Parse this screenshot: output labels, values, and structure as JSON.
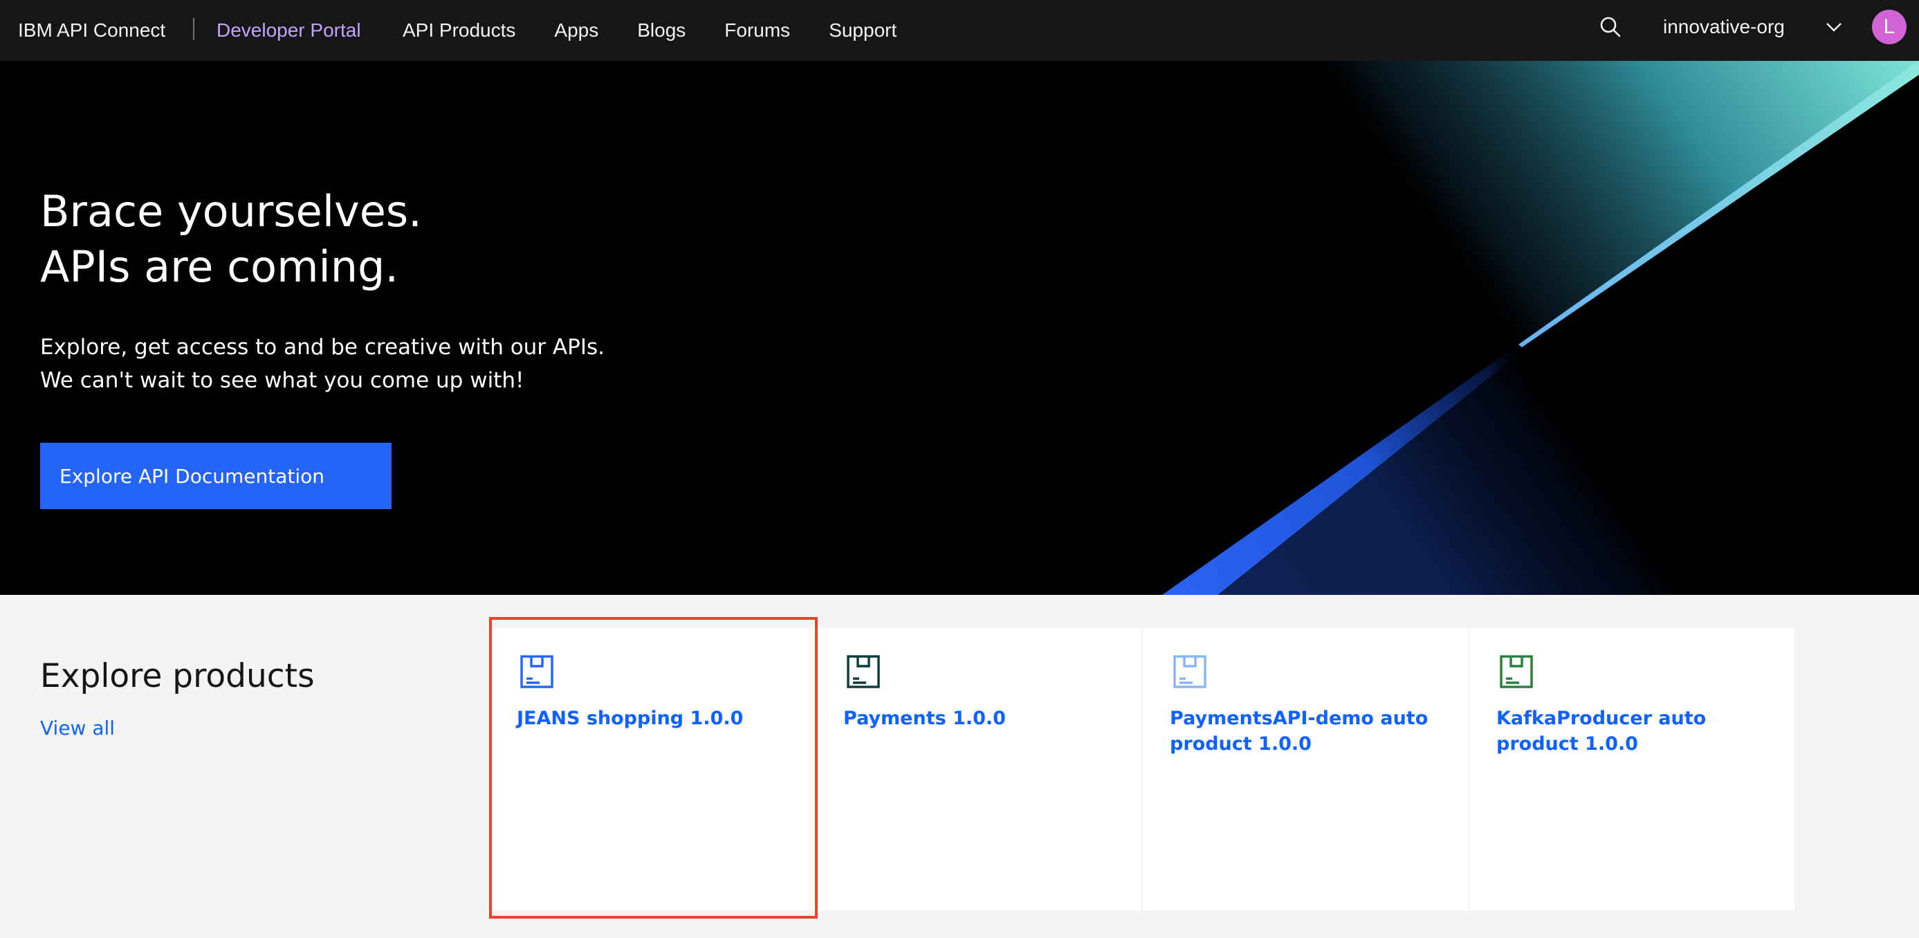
{
  "header": {
    "brand": "IBM API Connect",
    "portal_label": "Developer Portal",
    "nav_items": [
      {
        "label": "API Products"
      },
      {
        "label": "Apps"
      },
      {
        "label": "Blogs"
      },
      {
        "label": "Forums"
      },
      {
        "label": "Support"
      }
    ],
    "org_name": "innovative-org",
    "avatar_initial": "L",
    "icons": {
      "search": "search-icon",
      "org_dropdown": "chevron-down-icon"
    }
  },
  "hero": {
    "title_line1": "Brace yourselves.",
    "title_line2": "APIs are coming.",
    "subtitle_line1": "Explore, get access to and be creative with our APIs.",
    "subtitle_line2": "We can't wait to see what you come up with!",
    "cta_label": "Explore API Documentation"
  },
  "products": {
    "heading": "Explore products",
    "view_all_label": "View all",
    "items": [
      {
        "title": "JEANS shopping 1.0.0",
        "icon": "product-box-icon",
        "icon_color": "#2465f7",
        "selected": true
      },
      {
        "title": "Payments 1.0.0",
        "icon": "product-box-icon",
        "icon_color": "#0c3a3a",
        "selected": false
      },
      {
        "title": "PaymentsAPI-demo auto product 1.0.0",
        "icon": "product-box-icon",
        "icon_color": "#8ab4f8",
        "selected": false
      },
      {
        "title": "KafkaProducer auto product 1.0.0",
        "icon": "product-box-icon",
        "icon_color": "#24803b",
        "selected": false
      }
    ]
  },
  "colors": {
    "header_bg": "#161616",
    "portal_accent": "#c4a3ff",
    "cta_bg": "#2465f7",
    "link": "#0f62fe",
    "highlight_border": "#e5452f",
    "avatar_bg": "#d163d6"
  }
}
